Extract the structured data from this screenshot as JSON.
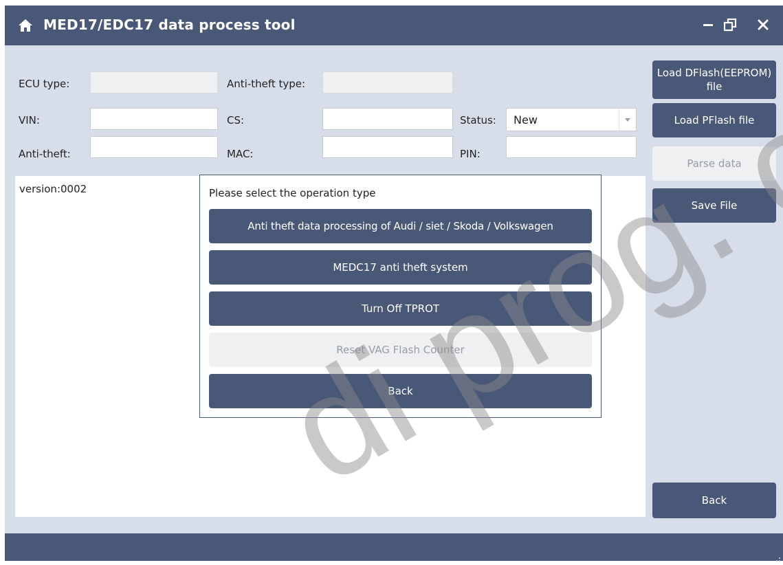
{
  "window": {
    "title": "MED17/EDC17 data process tool",
    "icons": {
      "home": "home-icon",
      "minimize": "minimize-icon",
      "restore": "restore-icon",
      "close": "close-icon"
    }
  },
  "form": {
    "ecu_type_label": "ECU type:",
    "ecu_type_value": "",
    "anti_theft_type_label": "Anti-theft type:",
    "anti_theft_type_value": "",
    "vin_label": "VIN:",
    "vin_value": "",
    "cs_label": "CS:",
    "cs_value": "",
    "status_label": "Status:",
    "status_value": "New",
    "anti_theft_label": "Anti-theft:",
    "anti_theft_value": "",
    "mac_label": "MAC:",
    "mac_value": "",
    "pin_label": "PIN:",
    "pin_value": ""
  },
  "log": {
    "text": "version:0002"
  },
  "sidebar": {
    "load_dflash": "Load DFlash(EEPROM) file",
    "load_pflash": "Load PFlash file",
    "parse_data": "Parse data",
    "save_file": "Save File",
    "back": "Back"
  },
  "dialog": {
    "title": "Please select the operation type",
    "options": [
      "Anti theft data processing of Audi / siet / Skoda / Volkswagen",
      "MEDC17 anti theft system",
      "Turn Off TPROT",
      "Reset VAG Flash Counter",
      "Back"
    ]
  },
  "watermark": "di prog. co",
  "colors": {
    "primary": "#4a5878",
    "background": "#d7deea",
    "disabled": "#eef0f2"
  }
}
